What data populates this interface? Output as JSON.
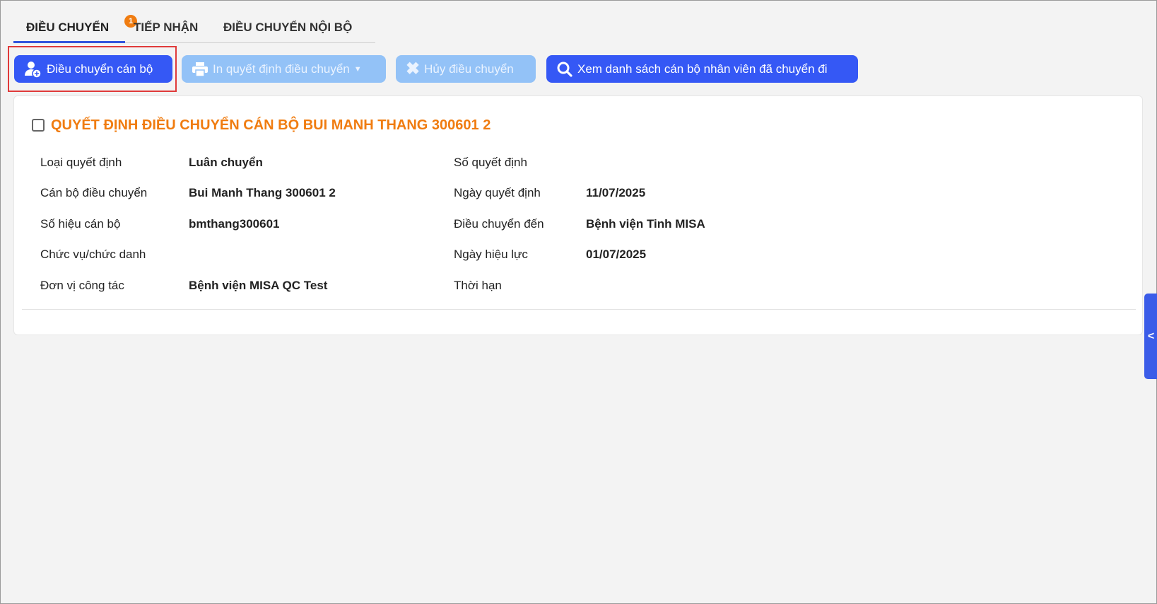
{
  "tabs": [
    {
      "label": "ĐIỀU CHUYỂN",
      "badge": "1"
    },
    {
      "label": "TIẾP NHẬN"
    },
    {
      "label": "ĐIỀU CHUYỂN NỘI BỘ"
    }
  ],
  "toolbar": {
    "transfer": "Điều chuyển cán bộ",
    "print": "In quyết định điều chuyển",
    "cancel": "Hủy điều chuyển",
    "view_list": "Xem danh sách cán bộ nhân viên đã chuyển đi"
  },
  "card": {
    "title": "QUYẾT ĐỊNH ĐIỀU CHUYỂN CÁN BỘ BUI MANH THANG 300601 2",
    "left": [
      {
        "label": "Loại quyết định",
        "value": "Luân chuyển"
      },
      {
        "label": "Cán bộ điều chuyển",
        "value": "Bui Manh Thang 300601 2"
      },
      {
        "label": "Số hiệu cán bộ",
        "value": "bmthang300601"
      },
      {
        "label": "Chức vụ/chức danh",
        "value": ""
      },
      {
        "label": "Đơn vị công tác",
        "value": "Bệnh viện MISA QC Test"
      }
    ],
    "right": [
      {
        "label": "Số quyết định",
        "value": ""
      },
      {
        "label": "Ngày quyết định",
        "value": "11/07/2025"
      },
      {
        "label": "Điều chuyển đến",
        "value": "Bệnh viện Tinh MISA"
      },
      {
        "label": "Ngày hiệu lực",
        "value": "01/07/2025"
      },
      {
        "label": "Thời hạn",
        "value": ""
      }
    ]
  },
  "colors": {
    "primary": "#3558f5",
    "accent": "#f07c10",
    "disabled": "#93c2f7"
  }
}
